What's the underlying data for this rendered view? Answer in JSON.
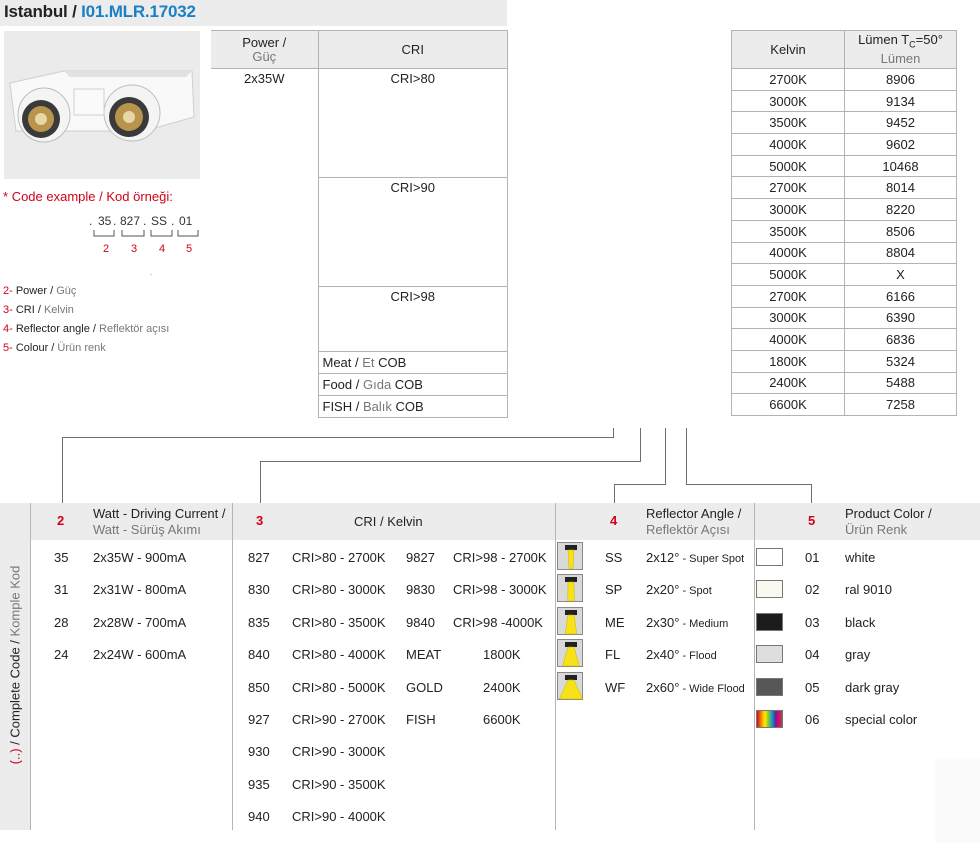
{
  "header": {
    "title_main": "Istanbul",
    "title_sep": " / ",
    "title_code": "I01.MLR.17032"
  },
  "code_example": {
    "label_en": "Code example",
    "label_sep": " / ",
    "label_tr": "Kod örneği:",
    "parts": [
      ".",
      "35",
      ".",
      "827",
      ".",
      "SS",
      ".",
      "01"
    ],
    "numbers": [
      "2",
      "3",
      "4",
      "5"
    ]
  },
  "legend": [
    {
      "num": "2-",
      "en": "Power",
      "tr": "Güç"
    },
    {
      "num": "3-",
      "en": "CRI",
      "tr": "Kelvin"
    },
    {
      "num": "4-",
      "en": "Reflector angle",
      "tr": "Reflektör açısı"
    },
    {
      "num": "5-",
      "en": "Colour",
      "tr": "Ürün renk"
    }
  ],
  "power_table": {
    "head_power_en": "Power /",
    "head_power_tr": "Güç",
    "head_cri": "CRI",
    "power": "2x35W",
    "groups": [
      "CRI>80",
      "CRI>90",
      "CRI>98"
    ],
    "specials": [
      {
        "en": "Meat",
        "tr": "Et",
        "suffix": "COB"
      },
      {
        "en": "Food",
        "tr": "Gıda",
        "suffix": "COB"
      },
      {
        "en": "FISH",
        "tr": "Balık",
        "suffix": "COB"
      }
    ]
  },
  "lumen_table": {
    "head_kelvin": "Kelvin",
    "head_lumen": "Lümen T",
    "head_lumen_sub": "C",
    "head_lumen_tail": "=50°",
    "head_lumen_tr": "Lümen",
    "rows": [
      [
        "2700K",
        "8906"
      ],
      [
        "3000K",
        "9134"
      ],
      [
        "3500K",
        "9452"
      ],
      [
        "4000K",
        "9602"
      ],
      [
        "5000K",
        "10468"
      ],
      [
        "2700K",
        "8014"
      ],
      [
        "3000K",
        "8220"
      ],
      [
        "3500K",
        "8506"
      ],
      [
        "4000K",
        "8804"
      ],
      [
        "5000K",
        "X"
      ],
      [
        "2700K",
        "6166"
      ],
      [
        "3000K",
        "6390"
      ],
      [
        "4000K",
        "6836"
      ],
      [
        "1800K",
        "5324"
      ],
      [
        "2400K",
        "5488"
      ],
      [
        "6600K",
        "7258"
      ]
    ]
  },
  "bottom": {
    "side_label": {
      "paren": "(..)",
      "en": " / Complete Code / ",
      "tr": "Komple Kod"
    },
    "watt": {
      "num": "2",
      "title_en": "Watt - Driving Current /",
      "title_tr": "Watt - Sürüş Akımı",
      "rows": [
        [
          "35",
          "2x35W - 900mA"
        ],
        [
          "31",
          "2x31W - 800mA"
        ],
        [
          "28",
          "2x28W - 700mA"
        ],
        [
          "24",
          "2x24W - 600mA"
        ]
      ]
    },
    "cri": {
      "num": "3",
      "title": "CRI / Kelvin",
      "left": [
        [
          "827",
          "CRI>80 - 2700K"
        ],
        [
          "830",
          "CRI>80 - 3000K"
        ],
        [
          "835",
          "CRI>80 - 3500K"
        ],
        [
          "840",
          "CRI>80 - 4000K"
        ],
        [
          "850",
          "CRI>80 - 5000K"
        ],
        [
          "927",
          "CRI>90 - 2700K"
        ],
        [
          "930",
          "CRI>90 - 3000K"
        ],
        [
          "935",
          "CRI>90 - 3500K"
        ],
        [
          "940",
          "CRI>90 - 4000K"
        ]
      ],
      "right": [
        [
          "9827",
          "CRI>98 - 2700K"
        ],
        [
          "9830",
          "CRI>98 - 3000K"
        ],
        [
          "9840",
          "CRI>98 -4000K"
        ],
        [
          "MEAT",
          "1800K"
        ],
        [
          "GOLD",
          "2400K"
        ],
        [
          "FISH",
          "6600K"
        ]
      ]
    },
    "reflector": {
      "num": "4",
      "title_en": "Reflector Angle /",
      "title_tr": "Reflektör Açısı",
      "rows": [
        {
          "code": "SS",
          "angle": "2x12°",
          "desc": " - Super Spot",
          "beam": 0.15
        },
        {
          "code": "SP",
          "angle": "2x20°",
          "desc": " - Spot",
          "beam": 0.25
        },
        {
          "code": "ME",
          "angle": "2x30°",
          "desc": " - Medium",
          "beam": 0.45
        },
        {
          "code": "FL",
          "angle": "2x40°",
          "desc": " - Flood",
          "beam": 0.65
        },
        {
          "code": "WF",
          "angle": "2x60°",
          "desc": " - Wide Flood",
          "beam": 0.9
        }
      ]
    },
    "color": {
      "num": "5",
      "title_en": "Product Color /",
      "title_tr": "Ürün Renk",
      "rows": [
        {
          "code": "01",
          "name": "white",
          "hex": "#ffffff"
        },
        {
          "code": "02",
          "name": "ral 9010",
          "hex": "#fbf9ef"
        },
        {
          "code": "03",
          "name": "black",
          "hex": "#1c1c1c"
        },
        {
          "code": "04",
          "name": "gray",
          "hex": "#dedede"
        },
        {
          "code": "05",
          "name": "dark gray",
          "hex": "#555759"
        },
        {
          "code": "06",
          "name": "special color",
          "hex": "multicolor"
        }
      ]
    }
  }
}
